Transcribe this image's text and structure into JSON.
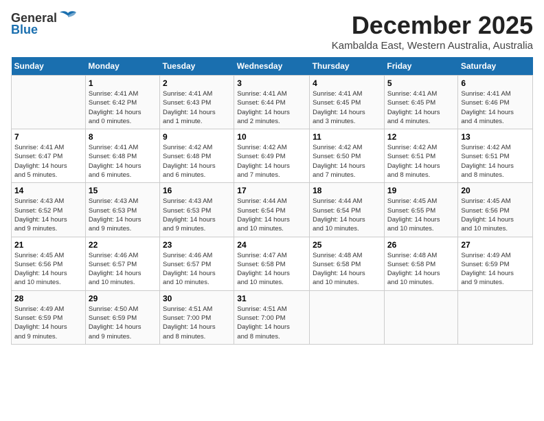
{
  "header": {
    "logo_general": "General",
    "logo_blue": "Blue",
    "month": "December 2025",
    "location": "Kambalda East, Western Australia, Australia"
  },
  "weekdays": [
    "Sunday",
    "Monday",
    "Tuesday",
    "Wednesday",
    "Thursday",
    "Friday",
    "Saturday"
  ],
  "weeks": [
    [
      {
        "day": "",
        "detail": ""
      },
      {
        "day": "1",
        "detail": "Sunrise: 4:41 AM\nSunset: 6:42 PM\nDaylight: 14 hours\nand 0 minutes."
      },
      {
        "day": "2",
        "detail": "Sunrise: 4:41 AM\nSunset: 6:43 PM\nDaylight: 14 hours\nand 1 minute."
      },
      {
        "day": "3",
        "detail": "Sunrise: 4:41 AM\nSunset: 6:44 PM\nDaylight: 14 hours\nand 2 minutes."
      },
      {
        "day": "4",
        "detail": "Sunrise: 4:41 AM\nSunset: 6:45 PM\nDaylight: 14 hours\nand 3 minutes."
      },
      {
        "day": "5",
        "detail": "Sunrise: 4:41 AM\nSunset: 6:45 PM\nDaylight: 14 hours\nand 4 minutes."
      },
      {
        "day": "6",
        "detail": "Sunrise: 4:41 AM\nSunset: 6:46 PM\nDaylight: 14 hours\nand 4 minutes."
      }
    ],
    [
      {
        "day": "7",
        "detail": "Sunrise: 4:41 AM\nSunset: 6:47 PM\nDaylight: 14 hours\nand 5 minutes."
      },
      {
        "day": "8",
        "detail": "Sunrise: 4:41 AM\nSunset: 6:48 PM\nDaylight: 14 hours\nand 6 minutes."
      },
      {
        "day": "9",
        "detail": "Sunrise: 4:42 AM\nSunset: 6:48 PM\nDaylight: 14 hours\nand 6 minutes."
      },
      {
        "day": "10",
        "detail": "Sunrise: 4:42 AM\nSunset: 6:49 PM\nDaylight: 14 hours\nand 7 minutes."
      },
      {
        "day": "11",
        "detail": "Sunrise: 4:42 AM\nSunset: 6:50 PM\nDaylight: 14 hours\nand 7 minutes."
      },
      {
        "day": "12",
        "detail": "Sunrise: 4:42 AM\nSunset: 6:51 PM\nDaylight: 14 hours\nand 8 minutes."
      },
      {
        "day": "13",
        "detail": "Sunrise: 4:42 AM\nSunset: 6:51 PM\nDaylight: 14 hours\nand 8 minutes."
      }
    ],
    [
      {
        "day": "14",
        "detail": "Sunrise: 4:43 AM\nSunset: 6:52 PM\nDaylight: 14 hours\nand 9 minutes."
      },
      {
        "day": "15",
        "detail": "Sunrise: 4:43 AM\nSunset: 6:53 PM\nDaylight: 14 hours\nand 9 minutes."
      },
      {
        "day": "16",
        "detail": "Sunrise: 4:43 AM\nSunset: 6:53 PM\nDaylight: 14 hours\nand 9 minutes."
      },
      {
        "day": "17",
        "detail": "Sunrise: 4:44 AM\nSunset: 6:54 PM\nDaylight: 14 hours\nand 10 minutes."
      },
      {
        "day": "18",
        "detail": "Sunrise: 4:44 AM\nSunset: 6:54 PM\nDaylight: 14 hours\nand 10 minutes."
      },
      {
        "day": "19",
        "detail": "Sunrise: 4:45 AM\nSunset: 6:55 PM\nDaylight: 14 hours\nand 10 minutes."
      },
      {
        "day": "20",
        "detail": "Sunrise: 4:45 AM\nSunset: 6:56 PM\nDaylight: 14 hours\nand 10 minutes."
      }
    ],
    [
      {
        "day": "21",
        "detail": "Sunrise: 4:45 AM\nSunset: 6:56 PM\nDaylight: 14 hours\nand 10 minutes."
      },
      {
        "day": "22",
        "detail": "Sunrise: 4:46 AM\nSunset: 6:57 PM\nDaylight: 14 hours\nand 10 minutes."
      },
      {
        "day": "23",
        "detail": "Sunrise: 4:46 AM\nSunset: 6:57 PM\nDaylight: 14 hours\nand 10 minutes."
      },
      {
        "day": "24",
        "detail": "Sunrise: 4:47 AM\nSunset: 6:58 PM\nDaylight: 14 hours\nand 10 minutes."
      },
      {
        "day": "25",
        "detail": "Sunrise: 4:48 AM\nSunset: 6:58 PM\nDaylight: 14 hours\nand 10 minutes."
      },
      {
        "day": "26",
        "detail": "Sunrise: 4:48 AM\nSunset: 6:58 PM\nDaylight: 14 hours\nand 10 minutes."
      },
      {
        "day": "27",
        "detail": "Sunrise: 4:49 AM\nSunset: 6:59 PM\nDaylight: 14 hours\nand 9 minutes."
      }
    ],
    [
      {
        "day": "28",
        "detail": "Sunrise: 4:49 AM\nSunset: 6:59 PM\nDaylight: 14 hours\nand 9 minutes."
      },
      {
        "day": "29",
        "detail": "Sunrise: 4:50 AM\nSunset: 6:59 PM\nDaylight: 14 hours\nand 9 minutes."
      },
      {
        "day": "30",
        "detail": "Sunrise: 4:51 AM\nSunset: 7:00 PM\nDaylight: 14 hours\nand 8 minutes."
      },
      {
        "day": "31",
        "detail": "Sunrise: 4:51 AM\nSunset: 7:00 PM\nDaylight: 14 hours\nand 8 minutes."
      },
      {
        "day": "",
        "detail": ""
      },
      {
        "day": "",
        "detail": ""
      },
      {
        "day": "",
        "detail": ""
      }
    ]
  ]
}
